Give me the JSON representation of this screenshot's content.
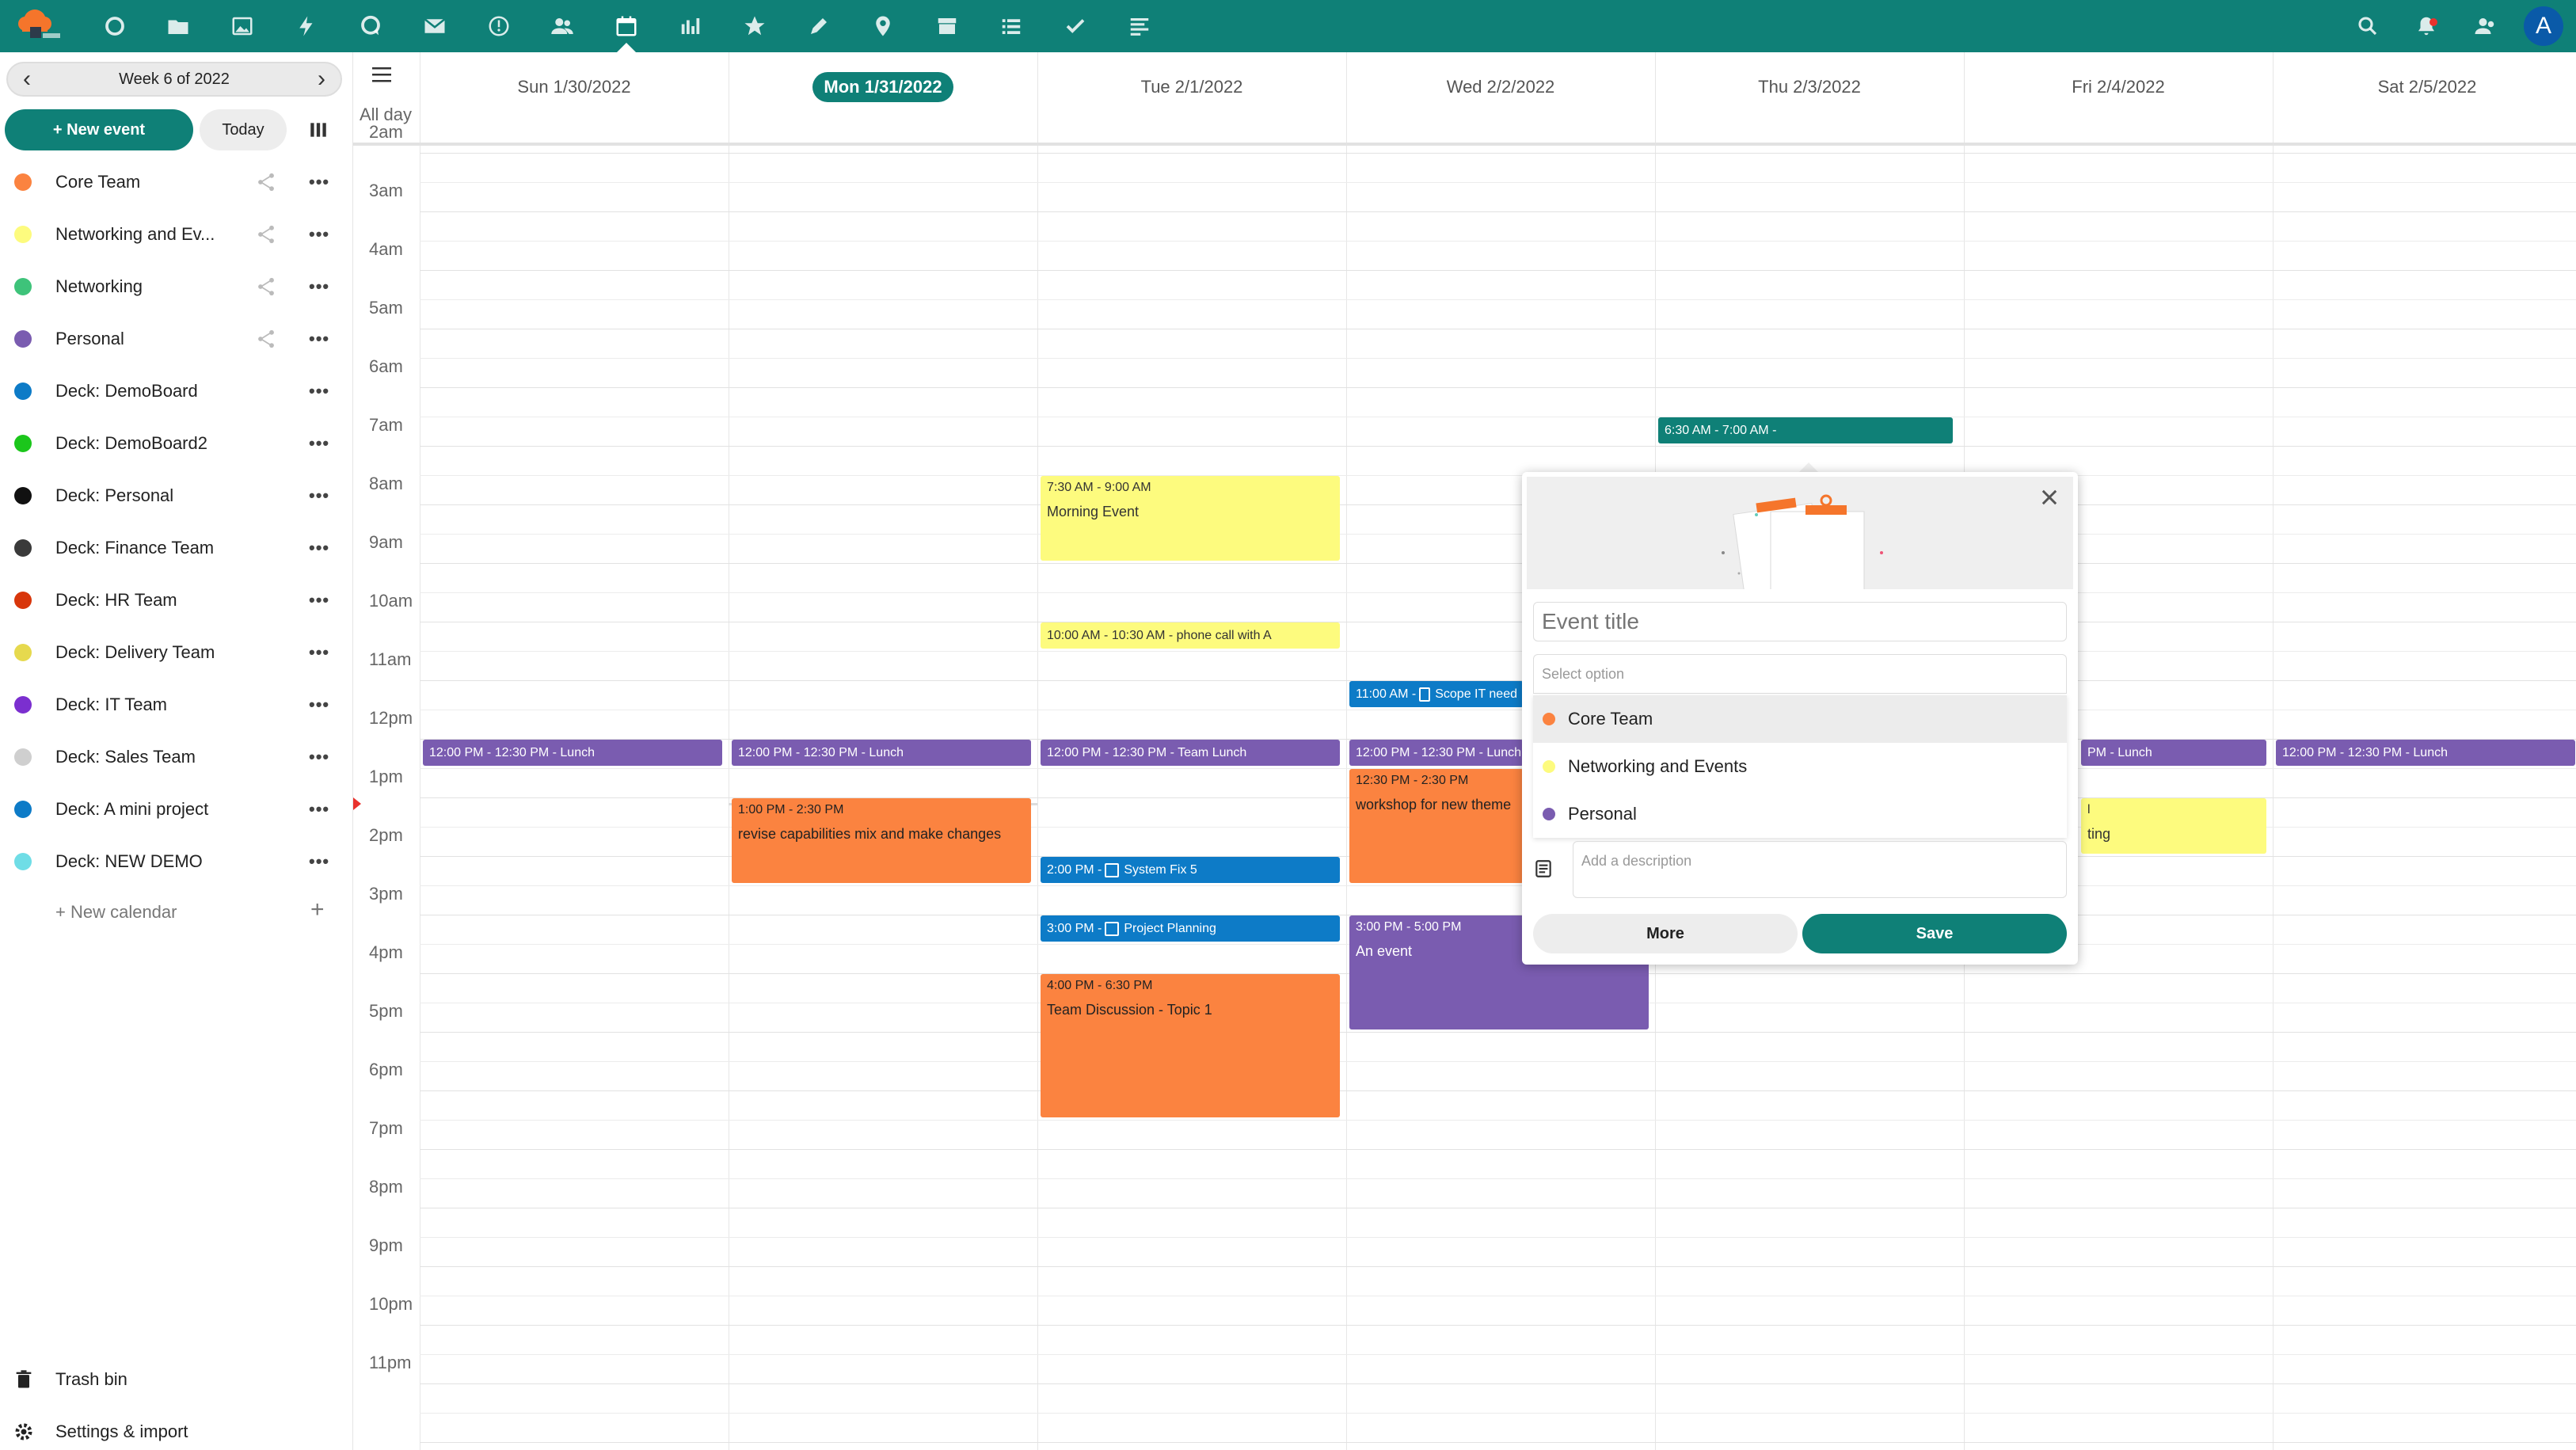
{
  "app": {
    "logo_label": "Nextcloud"
  },
  "topbar": {
    "apps": [
      "dashboard-icon",
      "files-icon",
      "photos-icon",
      "activity-icon",
      "talk-icon",
      "mail-icon",
      "deck-icon",
      "contacts-icon",
      "calendar-icon",
      "analytics-icon",
      "bookmarks-icon",
      "notes-icon",
      "maps-icon",
      "archive-icon",
      "tasks-icon",
      "checkmark-icon",
      "forms-icon"
    ],
    "active_app": "calendar-icon",
    "avatar_letter": "A"
  },
  "sidebar": {
    "week_label": "Week 6 of 2022",
    "new_event_label": "+ New event",
    "today_label": "Today",
    "calendars": [
      {
        "name": "Core Team",
        "color": "#fb8340",
        "shared": true
      },
      {
        "name": "Networking and Ev...",
        "color": "#fdfb7e",
        "shared": true
      },
      {
        "name": "Networking",
        "color": "#3ec37a",
        "shared": true
      },
      {
        "name": "Personal",
        "color": "#7a5cb0",
        "shared": true
      },
      {
        "name": "Deck: DemoBoard",
        "color": "#0d7bc7",
        "shared": false
      },
      {
        "name": "Deck: DemoBoard2",
        "color": "#1bc61b",
        "shared": false
      },
      {
        "name": "Deck: Personal",
        "color": "#111111",
        "shared": false
      },
      {
        "name": "Deck: Finance Team",
        "color": "#3a3a3a",
        "shared": false
      },
      {
        "name": "Deck: HR Team",
        "color": "#d8360b",
        "shared": false
      },
      {
        "name": "Deck: Delivery Team",
        "color": "#e6d94e",
        "shared": false
      },
      {
        "name": "Deck: IT Team",
        "color": "#7b2fcf",
        "shared": false
      },
      {
        "name": "Deck: Sales Team",
        "color": "#cfcfcf",
        "shared": false
      },
      {
        "name": "Deck: A mini project",
        "color": "#0d7bc7",
        "shared": false
      },
      {
        "name": "Deck: NEW DEMO",
        "color": "#6fdde6",
        "shared": false
      }
    ],
    "new_calendar_label": "+ New calendar",
    "trash_label": "Trash bin",
    "settings_label": "Settings & import"
  },
  "calendar": {
    "days": [
      "Sun 1/30/2022",
      "Mon 1/31/2022",
      "Tue 2/1/2022",
      "Wed 2/2/2022",
      "Thu 2/3/2022",
      "Fri 2/4/2022",
      "Sat 2/5/2022"
    ],
    "today_index": 1,
    "all_day_label": "All day",
    "hours": [
      "2am",
      "3am",
      "4am",
      "5am",
      "6am",
      "7am",
      "8am",
      "9am",
      "10am",
      "11am",
      "12pm",
      "1pm",
      "2pm",
      "3pm",
      "4pm",
      "5pm",
      "6pm",
      "7pm",
      "8pm",
      "9pm",
      "10pm",
      "11pm"
    ],
    "events": [
      {
        "day": 0,
        "start": 12.0,
        "end": 12.5,
        "color": "purple",
        "time": "12:00 PM - 12:30 PM - Lunch",
        "title": "",
        "single": true
      },
      {
        "day": 1,
        "start": 12.0,
        "end": 12.5,
        "color": "purple",
        "time": "12:00 PM - 12:30 PM - Lunch",
        "title": "",
        "single": true
      },
      {
        "day": 1,
        "start": 13.0,
        "end": 14.5,
        "color": "orange",
        "time": "1:00 PM - 2:30 PM",
        "title": "revise capabilities mix and make changes"
      },
      {
        "day": 2,
        "start": 7.5,
        "end": 9.0,
        "color": "yellow",
        "time": "7:30 AM - 9:00 AM",
        "title": "Morning Event"
      },
      {
        "day": 2,
        "start": 10.0,
        "end": 10.5,
        "color": "yellow",
        "time": "10:00 AM - 10:30 AM - phone call with A",
        "title": "",
        "single": true
      },
      {
        "day": 2,
        "start": 12.0,
        "end": 12.5,
        "color": "purple",
        "time": "12:00 PM - 12:30 PM - Team Lunch",
        "title": "",
        "single": true
      },
      {
        "day": 2,
        "start": 14.0,
        "end": 14.5,
        "color": "blue",
        "time": "2:00 PM - ",
        "task": "System Fix 5",
        "title": "",
        "single": true
      },
      {
        "day": 2,
        "start": 15.0,
        "end": 15.5,
        "color": "blue",
        "time": "3:00 PM - ",
        "task": "Project Planning",
        "title": "",
        "single": true
      },
      {
        "day": 2,
        "start": 16.0,
        "end": 18.5,
        "color": "orange",
        "time": "4:00 PM - 6:30 PM",
        "title": "Team Discussion - Topic 1"
      },
      {
        "day": 3,
        "start": 11.0,
        "end": 11.5,
        "color": "blue",
        "time": "11:00 AM - ",
        "task": "Scope IT need",
        "title": "",
        "single": true
      },
      {
        "day": 3,
        "start": 12.0,
        "end": 12.5,
        "color": "purple",
        "time": "12:00 PM - 12:30 PM - Lunch",
        "title": "",
        "single": true
      },
      {
        "day": 3,
        "start": 12.5,
        "end": 14.5,
        "color": "orange",
        "time": "12:30 PM - 2:30 PM",
        "title": "workshop for new theme"
      },
      {
        "day": 3,
        "start": 15.0,
        "end": 17.0,
        "color": "purple",
        "time": "3:00 PM - 5:00 PM",
        "title": "An event"
      },
      {
        "day": 4,
        "start": 6.5,
        "end": 7.0,
        "color": "teal",
        "time": "6:30 AM - 7:00 AM - ",
        "title": "",
        "single": true
      },
      {
        "day": 5,
        "start": 12.0,
        "end": 12.5,
        "color": "purple",
        "time": "PM - Lunch",
        "title": "",
        "single": true,
        "clip": true
      },
      {
        "day": 5,
        "start": 13.0,
        "end": 14.0,
        "color": "yellow",
        "time": "l",
        "title": "ting",
        "clip": true
      },
      {
        "day": 6,
        "start": 12.0,
        "end": 12.5,
        "color": "purple",
        "time": "12:00 PM - 12:30 PM - Lunch",
        "title": "",
        "single": true
      }
    ]
  },
  "popover": {
    "title_placeholder": "Event title",
    "select_placeholder": "Select option",
    "options": [
      {
        "name": "Core Team",
        "color": "#fb8340",
        "highlighted": true
      },
      {
        "name": "Networking and Events",
        "color": "#fdfb7e",
        "highlighted": false
      },
      {
        "name": "Personal",
        "color": "#7a5cb0",
        "highlighted": false
      }
    ],
    "description_placeholder": "Add a description",
    "more_label": "More",
    "save_label": "Save"
  }
}
